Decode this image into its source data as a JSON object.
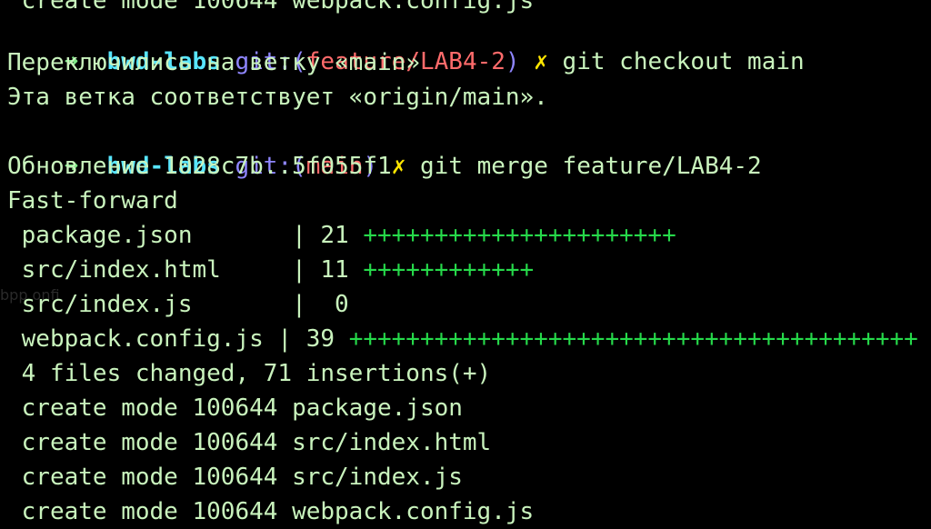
{
  "terminal": {
    "top_partial": " create mode 100644 webpack.config.js",
    "prompt": {
      "arrow": "➜",
      "dir": "bwd-labs",
      "git_prefix": "git:(",
      "git_suffix": ")",
      "dirty_mark": "✗"
    },
    "lines": {
      "p1_branch": "feature/LAB4-2",
      "p1_cmd": "git checkout main",
      "o1": "Переключились на ветку «main»",
      "o2": "Эта ветка соответствует «origin/main».",
      "p2_branch": "main",
      "p2_cmd": "git merge feature/LAB4-2",
      "o3": "Обновление 1028c7b..5f055f1",
      "o4": "Fast-forward",
      "stat": [
        {
          "file": " package.json       | 21 ",
          "plus": "++++++++++++++++++++++"
        },
        {
          "file": " src/index.html     | 11 ",
          "plus": "++++++++++++"
        },
        {
          "file": " src/index.js       |  0",
          "plus": ""
        },
        {
          "file": " webpack.config.js | 39 ",
          "plus": "++++++++++++++++++++++++++++++++++++++++"
        }
      ],
      "summary": " 4 files changed, 71 insertions(+)",
      "create": [
        " create mode 100644 package.json",
        " create mode 100644 src/index.html",
        " create mode 100644 src/index.js",
        " create mode 100644 webpack.config.js"
      ]
    },
    "ghost_text": "bpp  onfi"
  },
  "colors": {
    "background": "#000000",
    "text": "#c9f3bd",
    "prompt_arrow": "#7ee787",
    "directory": "#58e6ff",
    "git_label": "#8f86ff",
    "branch": "#ff6b6b",
    "dirty_mark": "#ffe600",
    "plus": "#26d94a"
  }
}
